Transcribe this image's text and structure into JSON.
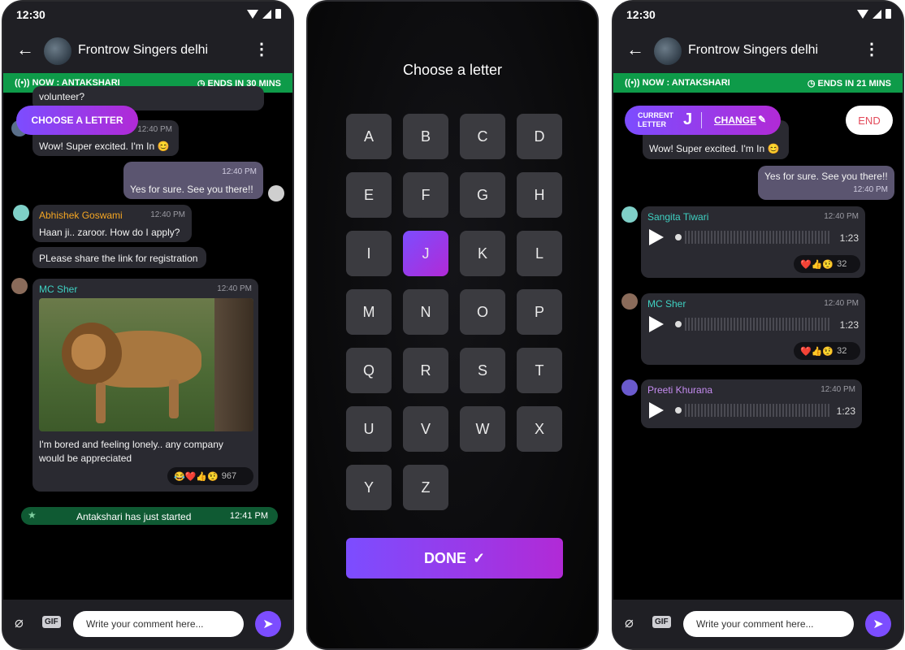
{
  "screen1": {
    "time": "12:30",
    "group_title": "Frontrow Singers delhi",
    "now_label": "NOW : ANTAKSHARI",
    "ends_label": "ENDS IN 30 MINS",
    "partial_text": "volunteer?",
    "choose_button": "CHOOSE  A LETTER",
    "messages": [
      {
        "time": "12:40 PM",
        "text": "Wow! Super excited. I'm In 😊"
      },
      {
        "time": "12:40 PM",
        "text": "Yes for sure. See you there!!"
      },
      {
        "sender": "Abhishek Goswami",
        "time": "12:40 PM",
        "text": "Haan ji.. zaroor. How do I apply?"
      },
      {
        "text": "PLease share the link for registration"
      },
      {
        "sender": "MC Sher",
        "time": "12:40 PM",
        "text": "I'm bored and feeling lonely.. any company would be appreciated",
        "reactions": "😂❤️👍🤨",
        "count": "967"
      }
    ],
    "system_message": "Antakshari has just started",
    "system_time": "12:41 PM",
    "gif_label": "GIF",
    "input_placeholder": "Write your comment here..."
  },
  "screen2": {
    "title": "Choose a letter",
    "letters": [
      "A",
      "B",
      "C",
      "D",
      "E",
      "F",
      "G",
      "H",
      "I",
      "J",
      "K",
      "L",
      "M",
      "N",
      "O",
      "P",
      "Q",
      "R",
      "S",
      "T",
      "U",
      "V",
      "W",
      "X",
      "Y",
      "Z"
    ],
    "selected": "J",
    "done_label": "DONE"
  },
  "screen3": {
    "time": "12:30",
    "group_title": "Frontrow Singers delhi",
    "now_label": "NOW : ANTAKSHARI",
    "ends_label": "ENDS IN 21 MINS",
    "current_letter_label": "CURRENT LETTER",
    "current_letter": "J",
    "change_label": "CHANGE",
    "end_label": "END",
    "messages": [
      {
        "text": "Wow! Super excited. I'm In 😊"
      },
      {
        "text": "Yes for sure. See you there!!",
        "time": "12:40 PM"
      },
      {
        "sender": "Sangita Tiwari",
        "time": "12:40 PM",
        "duration": "1:23",
        "reactions": "❤️👍🤨",
        "count": "32"
      },
      {
        "sender": "MC Sher",
        "time": "12:40 PM",
        "duration": "1:23",
        "reactions": "❤️👍🤨",
        "count": "32"
      },
      {
        "sender": "Preeti Khurana",
        "time": "12:40 PM",
        "duration": "1:23"
      }
    ],
    "gif_label": "GIF",
    "input_placeholder": "Write your comment here..."
  },
  "colors": {
    "accent": "#7c4dff",
    "accent2": "#b12ad6",
    "green": "#0e9b49",
    "bubble": "#2a2a31"
  },
  "icons": [
    "back-arrow-icon",
    "more-vert-icon",
    "radio-broadcast-icon",
    "clock-icon",
    "paperclip-icon",
    "gif-icon",
    "send-icon",
    "pencil-icon",
    "play-icon",
    "star-icon",
    "checkmark-icon"
  ]
}
